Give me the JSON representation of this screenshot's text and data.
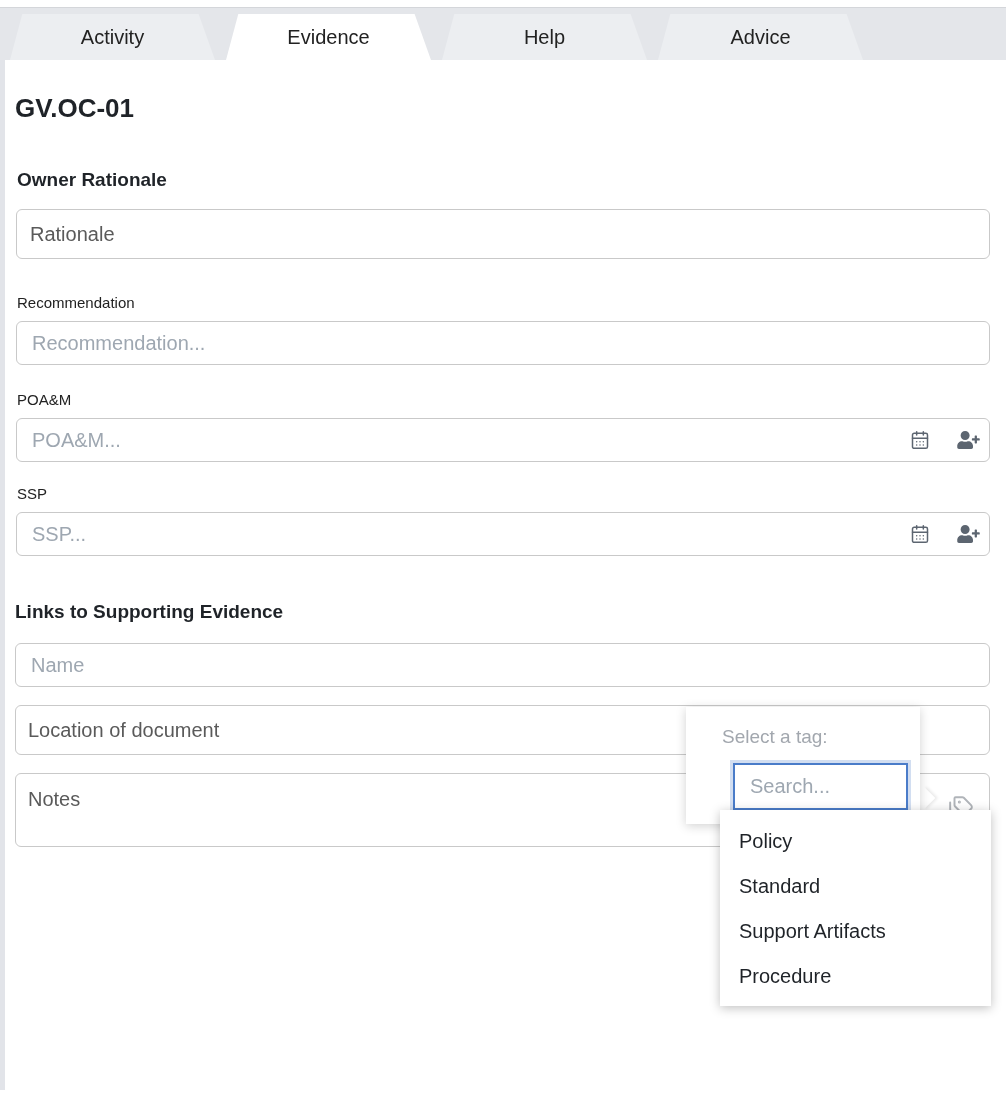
{
  "tabs": [
    {
      "label": "Activity",
      "selected": false
    },
    {
      "label": "Evidence",
      "selected": true
    },
    {
      "label": "Help",
      "selected": false
    },
    {
      "label": "Advice",
      "selected": false
    }
  ],
  "title": "GV.OC-01",
  "owner_rationale": {
    "heading": "Owner Rationale",
    "value": "Rationale"
  },
  "fields": [
    {
      "label": "Recommendation",
      "placeholder": "Recommendation...",
      "kind": "text"
    },
    {
      "label": "POA&M",
      "placeholder": "POA&M...",
      "kind": "dated"
    },
    {
      "label": "SSP",
      "placeholder": "SSP...",
      "kind": "dated"
    }
  ],
  "evidence": {
    "heading": "Links to Supporting Evidence",
    "name": {
      "placeholder": "Name"
    },
    "location": {
      "value": "Location of document"
    },
    "notes": {
      "value": "Notes"
    }
  },
  "tag_popover": {
    "prompt": "Select a tag:",
    "search": {
      "placeholder": "Search...",
      "focused": true
    },
    "options": [
      {
        "label": "Policy",
        "selected": false
      },
      {
        "label": "Standard",
        "selected": false
      },
      {
        "label": "Support Artifacts",
        "selected": false
      },
      {
        "label": "Procedure",
        "selected": false
      }
    ]
  }
}
